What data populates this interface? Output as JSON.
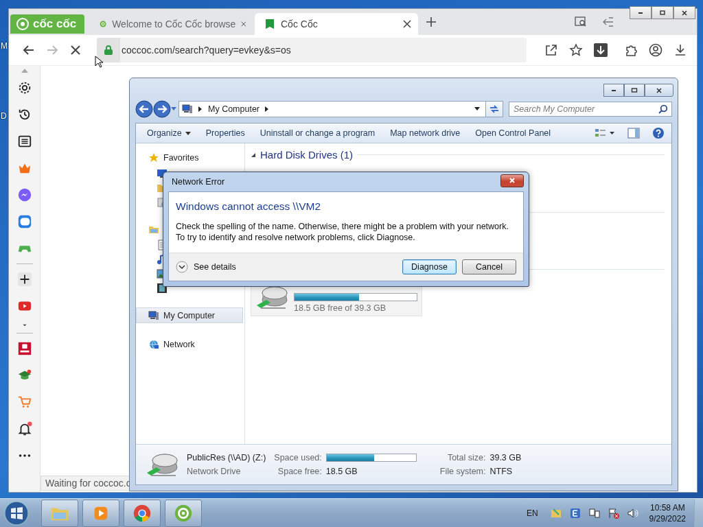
{
  "desktop_labels": [
    "M",
    "D"
  ],
  "browser": {
    "logo": {
      "label": "cốc cốc"
    },
    "tabs": [
      {
        "label": "Welcome to Cốc Cốc browse",
        "selected": false
      },
      {
        "label": "Cốc Cốc",
        "selected": true
      }
    ],
    "address": "coccoc.com/search?query=evkey&s=os",
    "loading": true,
    "sidebar": [
      {
        "kind": "settings"
      },
      {
        "kind": "history"
      },
      {
        "kind": "list"
      },
      {
        "kind": "crown"
      },
      {
        "kind": "messenger"
      },
      {
        "kind": "zalo"
      },
      {
        "kind": "game"
      },
      {
        "kind": "divider"
      },
      {
        "kind": "add"
      },
      {
        "kind": "youtube"
      },
      {
        "kind": "caret"
      },
      {
        "kind": "divider"
      },
      {
        "kind": "shop"
      },
      {
        "kind": "school"
      },
      {
        "kind": "cart"
      },
      {
        "kind": "bell"
      },
      {
        "kind": "more"
      }
    ],
    "status": "Waiting for coccoc.c"
  },
  "explorer": {
    "path": [
      "My Computer"
    ],
    "search": {
      "placeholder": "Search My Computer"
    },
    "commands": [
      {
        "label": "Organize",
        "menu": true
      },
      {
        "label": "Properties",
        "menu": false
      },
      {
        "label": "Uninstall or change a program",
        "menu": false
      },
      {
        "label": "Map network drive",
        "menu": false
      },
      {
        "label": "Open Control Panel",
        "menu": false
      }
    ],
    "nav": [
      {
        "kind": "favorites",
        "label": "Favorites",
        "selected": false,
        "children": [
          {
            "kind": "desktop"
          },
          {
            "kind": "folder"
          },
          {
            "kind": "recent"
          }
        ]
      },
      {
        "kind": "libraries",
        "selected": false,
        "children": [
          {
            "kind": "document"
          },
          {
            "kind": "music"
          },
          {
            "kind": "pictures"
          },
          {
            "kind": "videos"
          }
        ]
      },
      {
        "kind": "computer",
        "label": "My Computer",
        "selected": true
      },
      {
        "kind": "network",
        "label": "Network",
        "selected": false
      }
    ],
    "group": "Hard Disk Drives (1)",
    "drive": {
      "level": 0.53,
      "free": "18.5 GB free of 39.3 GB"
    },
    "details": {
      "name": "PublicRes (\\\\AD) (Z:)",
      "type": "Network Drive",
      "used_label": "Space used:",
      "level": 0.53,
      "free_label": "Space free:",
      "free": "18.5 GB",
      "total_label": "Total size:",
      "total": "39.3 GB",
      "fs_label": "File system:",
      "fs": "NTFS"
    }
  },
  "dialog": {
    "title": "Network Error",
    "heading": "Windows cannot access \\\\VM2",
    "message": "Check the spelling of the name. Otherwise, there might be a problem with your network. To try to identify and resolve network problems, click Diagnose.",
    "details": "See details",
    "buttons": [
      {
        "label": "Diagnose",
        "default": true
      },
      {
        "label": "Cancel",
        "default": false
      }
    ]
  },
  "taskbar": {
    "apps": [
      {
        "kind": "explorer"
      },
      {
        "kind": "media"
      },
      {
        "kind": "chrome"
      },
      {
        "kind": "coccoc"
      }
    ],
    "language": "EN",
    "time": "10:58 AM",
    "date": "9/29/2022"
  }
}
